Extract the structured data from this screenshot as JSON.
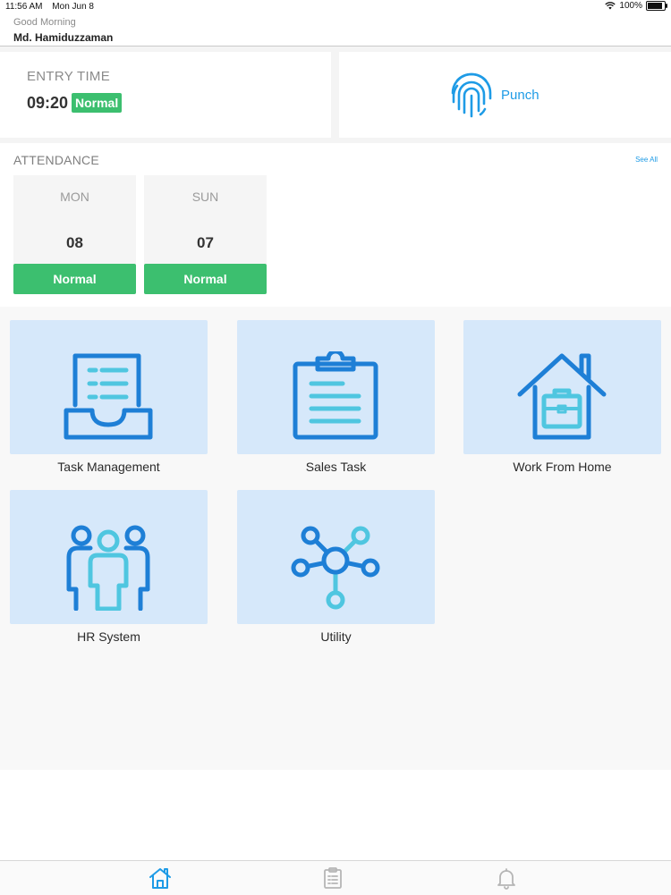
{
  "status_bar": {
    "time": "11:56 AM",
    "date": "Mon Jun 8",
    "battery": "100%",
    "battery_level": 1.0
  },
  "header": {
    "greeting": "Good Morning",
    "username": "Md. Hamiduzzaman"
  },
  "entry": {
    "label": "ENTRY TIME",
    "time": "09:20",
    "status": "Normal"
  },
  "punch": {
    "label": "Punch",
    "icon": "fingerprint-icon"
  },
  "attendance": {
    "title": "ATTENDANCE",
    "see_all": "See All",
    "days": [
      {
        "day": "MON",
        "date": "08",
        "status": "Normal"
      },
      {
        "day": "SUN",
        "date": "07",
        "status": "Normal"
      }
    ]
  },
  "menu": [
    {
      "label": "Task Management",
      "icon": "inbox-list-icon"
    },
    {
      "label": "Sales Task",
      "icon": "clipboard-icon"
    },
    {
      "label": "Work From Home",
      "icon": "house-briefcase-icon"
    },
    {
      "label": "HR System",
      "icon": "people-group-icon"
    },
    {
      "label": "Utility",
      "icon": "network-nodes-icon"
    }
  ],
  "tabs": [
    {
      "icon": "home-icon",
      "active": true
    },
    {
      "icon": "report-icon",
      "active": false
    },
    {
      "icon": "bell-icon",
      "active": false
    }
  ],
  "colors": {
    "accent": "#1e9be6",
    "success": "#3cbf6f",
    "tile_bg": "#d6e8fa",
    "icon_dark": "#1e7fd6",
    "icon_light": "#4fc6e0"
  }
}
